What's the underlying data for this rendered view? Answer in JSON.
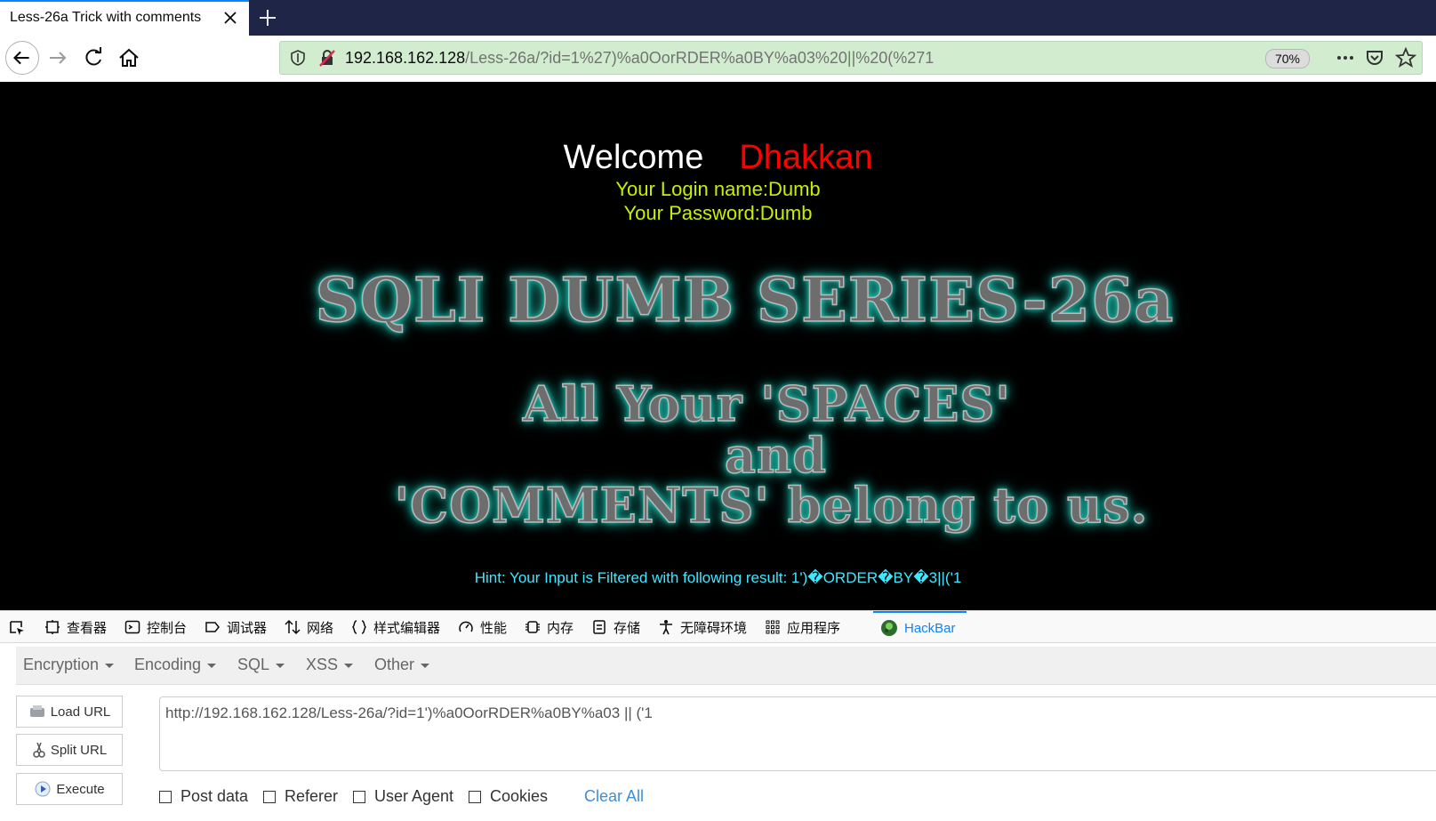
{
  "browser": {
    "tab_title": "Less-26a Trick with comments",
    "url_host": "192.168.162.128",
    "url_path": "/Less-26a/?id=1%27)%a0OorRDER%a0BY%a03%20||%20(%271",
    "zoom": "70%"
  },
  "page": {
    "welcome": "Welcome",
    "name": "Dhakkan",
    "login_line": "Your Login name:Dumb",
    "password_line": "Your Password:Dumb",
    "title": "SQLI DUMB SERIES-26a",
    "slogan1": "All Your 'SPACES'",
    "slogan2": "and",
    "slogan3": "'COMMENTS' belong to us.",
    "hint": "Hint: Your Input is Filtered with following result: 1')�ORDER�BY�3||('1"
  },
  "devtools": {
    "tabs": [
      {
        "label": "查看器",
        "icon": "inspector-icon"
      },
      {
        "label": "控制台",
        "icon": "console-icon"
      },
      {
        "label": "调试器",
        "icon": "debugger-icon"
      },
      {
        "label": "网络",
        "icon": "network-icon"
      },
      {
        "label": "样式编辑器",
        "icon": "style-editor-icon"
      },
      {
        "label": "性能",
        "icon": "performance-icon"
      },
      {
        "label": "内存",
        "icon": "memory-icon"
      },
      {
        "label": "存储",
        "icon": "storage-icon"
      },
      {
        "label": "无障碍环境",
        "icon": "accessibility-icon"
      },
      {
        "label": "应用程序",
        "icon": "application-icon"
      },
      {
        "label": "HackBar",
        "icon": "hackbar-icon"
      }
    ],
    "active_tab": "HackBar"
  },
  "hackbar": {
    "menu": [
      "Encryption",
      "Encoding",
      "SQL",
      "XSS",
      "Other"
    ],
    "load_url": "Load URL",
    "split_url": "Split URL",
    "execute": "Execute",
    "url_value": "http://192.168.162.128/Less-26a/?id=1')%a0OorRDER%a0BY%a03 || ('1",
    "options": [
      "Post data",
      "Referer",
      "User Agent",
      "Cookies"
    ],
    "clear_all": "Clear All"
  },
  "colors": {
    "tabstrip": "#1f2546",
    "urlbar": "#d2ecd0",
    "welcome_name": "#ff0000",
    "login_text": "#c6f000",
    "hint_text": "#3ee8ff",
    "glow": "#20c7b6",
    "active_accent": "#0a84ff"
  }
}
